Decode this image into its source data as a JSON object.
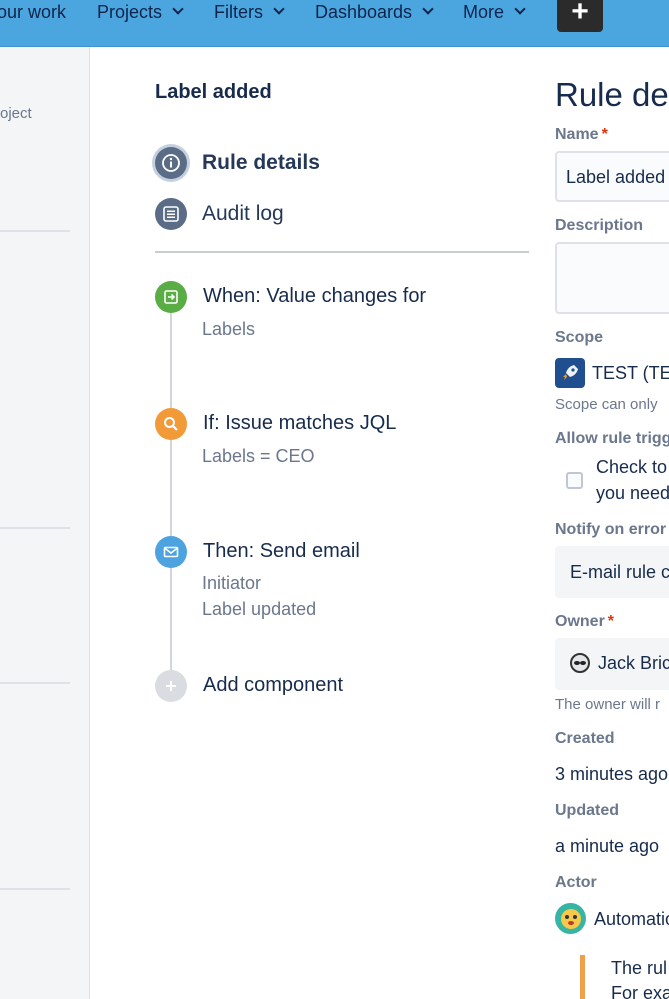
{
  "topnav": {
    "items": [
      {
        "label": "our work",
        "has_chevron": false
      },
      {
        "label": "Projects",
        "has_chevron": true
      },
      {
        "label": "Filters",
        "has_chevron": true
      },
      {
        "label": "Dashboards",
        "has_chevron": true
      },
      {
        "label": "More",
        "has_chevron": true
      }
    ],
    "create_label": "+",
    "accent_color": "#4ba6e0"
  },
  "sidebar": {
    "partial_text": "oject"
  },
  "rule": {
    "title": "Label added",
    "menu": [
      {
        "label": "Rule details",
        "icon": "info-icon",
        "active": true
      },
      {
        "label": "Audit log",
        "icon": "list-icon",
        "active": false
      }
    ],
    "components": [
      {
        "title": "When: Value changes for",
        "subs": [
          "Labels"
        ],
        "icon": "trigger-icon",
        "color": "#5aac44"
      },
      {
        "title": "If: Issue matches JQL",
        "subs": [
          "Labels = CEO"
        ],
        "icon": "search-icon",
        "color": "#f29a38"
      },
      {
        "title": "Then: Send email",
        "subs": [
          "Initiator",
          "Label updated"
        ],
        "icon": "mail-icon",
        "color": "#4da3e0"
      },
      {
        "title": "Add component",
        "subs": [],
        "icon": "plus-icon",
        "color": "#d9dce0"
      }
    ]
  },
  "details": {
    "heading": "Rule deta",
    "name_label": "Name",
    "name_value": "Label added",
    "required_mark": "*",
    "description_label": "Description",
    "description_value": "",
    "scope_label": "Scope",
    "scope_value": "TEST (TE",
    "scope_help": "Scope can only",
    "allow_label": "Allow rule trigg",
    "check_line1": "Check to",
    "check_line2": "you need",
    "notify_label": "Notify on error",
    "notify_value": "E-mail rule c",
    "owner_label": "Owner",
    "owner_value": "Jack Bric",
    "owner_help": "The owner will r",
    "created_label": "Created",
    "created_value": "3 minutes ago",
    "updated_label": "Updated",
    "updated_value": "a minute ago",
    "actor_label": "Actor",
    "actor_value": "Automatio",
    "note_line1": "The rul",
    "note_line2": "For exa"
  }
}
